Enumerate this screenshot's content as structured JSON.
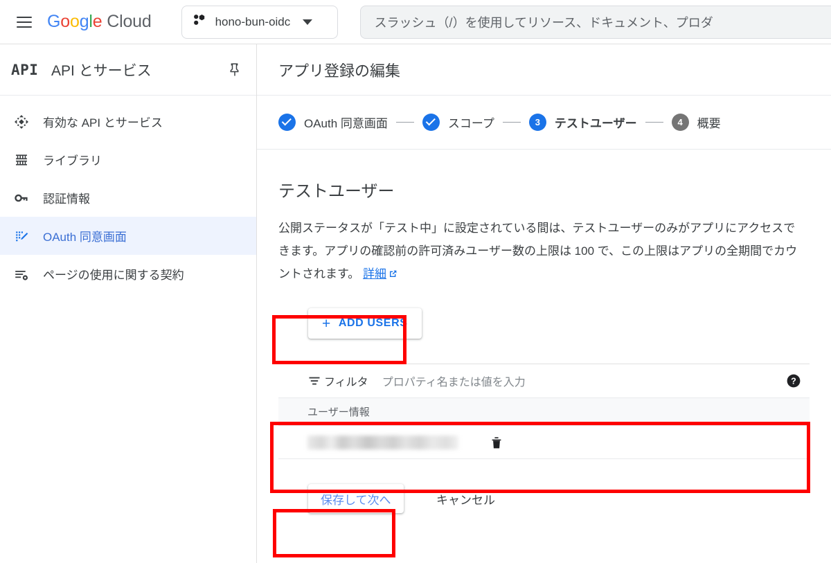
{
  "topbar": {
    "menu_icon": "hamburger-menu-icon",
    "brand": {
      "google": "Google",
      "cloud": "Cloud"
    },
    "project": {
      "icon": "project-dots-icon",
      "name": "hono-bun-oidc",
      "caret_icon": "chevron-down-icon"
    },
    "search": {
      "placeholder": "スラッシュ（/）を使用してリソース、ドキュメント、プロダ"
    }
  },
  "sidebar": {
    "logo_text": "API",
    "title": "API とサービス",
    "pin_icon": "pin-icon",
    "items": [
      {
        "icon": "four-direction-arrow-icon",
        "label": "有効な API とサービス",
        "active": false
      },
      {
        "icon": "library-columns-icon",
        "label": "ライブラリ",
        "active": false
      },
      {
        "icon": "key-icon",
        "label": "認証情報",
        "active": false
      },
      {
        "icon": "oauth-consent-pencil-icon",
        "label": "OAuth 同意画面",
        "active": true
      },
      {
        "icon": "list-gear-icon",
        "label": "ページの使用に関する契約",
        "active": false
      }
    ]
  },
  "main": {
    "header_title": "アプリ登録の編集",
    "stepper": [
      {
        "marker": "check",
        "number": "1",
        "label": "OAuth 同意画面",
        "state": "done"
      },
      {
        "marker": "check",
        "number": "2",
        "label": "スコープ",
        "state": "done"
      },
      {
        "marker": "number",
        "number": "3",
        "label": "テストユーザー",
        "state": "current"
      },
      {
        "marker": "number",
        "number": "4",
        "label": "概要",
        "state": "todo"
      }
    ],
    "section": {
      "title": "テストユーザー",
      "paragraph": "公開ステータスが「テスト中」に設定されている間は、テストユーザーのみがアプリにアクセスできます。アプリの確認前の許可済みユーザー数の上限は 100 で、この上限はアプリの全期間でカウントされます。",
      "link_text": "詳細",
      "link_external_icon": "external-link-icon"
    },
    "add_users_button": {
      "plus_icon": "plus-icon",
      "label": "ADD USERS"
    },
    "table": {
      "filter": {
        "icon": "filter-icon",
        "label": "フィルタ",
        "placeholder": "プロパティ名または値を入力"
      },
      "help_icon": "help-circle-icon",
      "columns": [
        "ユーザー情報"
      ],
      "rows": [
        {
          "user_info": "",
          "redacted": true,
          "delete_icon": "trash-icon"
        }
      ]
    },
    "footer": {
      "save_label": "保存して次へ",
      "cancel_label": "キャンセル"
    }
  },
  "annotations": {
    "color": "#fe0000",
    "boxes": [
      {
        "name": "highlight-add-users"
      },
      {
        "name": "highlight-user-table"
      },
      {
        "name": "highlight-save-button"
      }
    ]
  }
}
